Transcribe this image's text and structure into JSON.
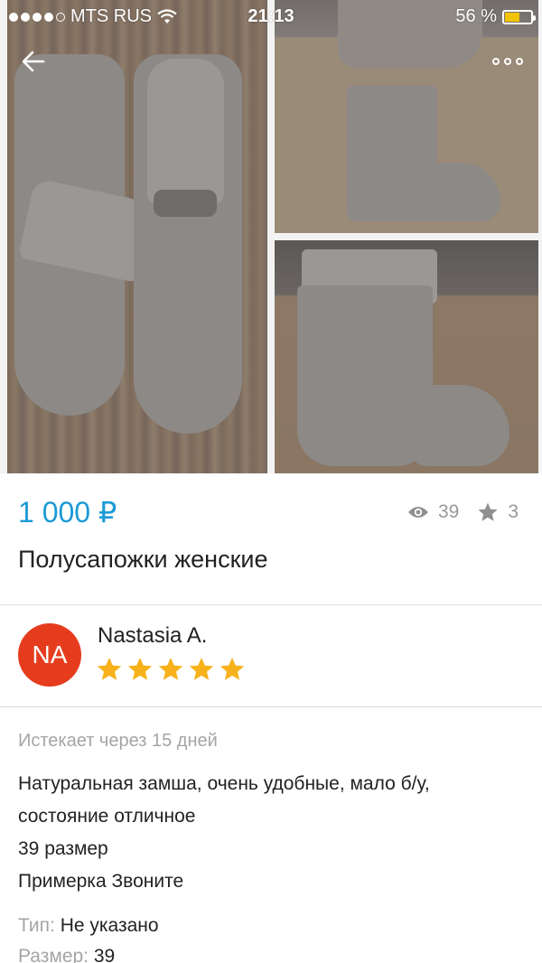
{
  "status_bar": {
    "carrier": "MTS RUS",
    "time": "21:13",
    "battery": "56 %",
    "battery_level": 0.56,
    "battery_color": "#f2c300"
  },
  "nav": {
    "back_icon": "back-arrow-icon",
    "more_icon": "more-options-icon"
  },
  "listing": {
    "price": "1 000 ₽",
    "price_color": "#1d9ad6",
    "views": "39",
    "favorites": "3",
    "title": "Полусапожки женские"
  },
  "seller": {
    "initials": "NA",
    "name": "Nastasia A.",
    "avatar_color": "#e63c1e",
    "rating": 5,
    "rating_max": 5,
    "star_color": "#f7b21b"
  },
  "details": {
    "expires": "Истекает через 15 дней",
    "description_lines": [
      "Натуральная замша, очень удобные, мало б/у,",
      "состояние отличное",
      "39 размер",
      "Примерка Звоните"
    ],
    "params": [
      {
        "key": "Тип:",
        "value": "Не указано"
      },
      {
        "key": "Размер:",
        "value": "39"
      }
    ]
  }
}
